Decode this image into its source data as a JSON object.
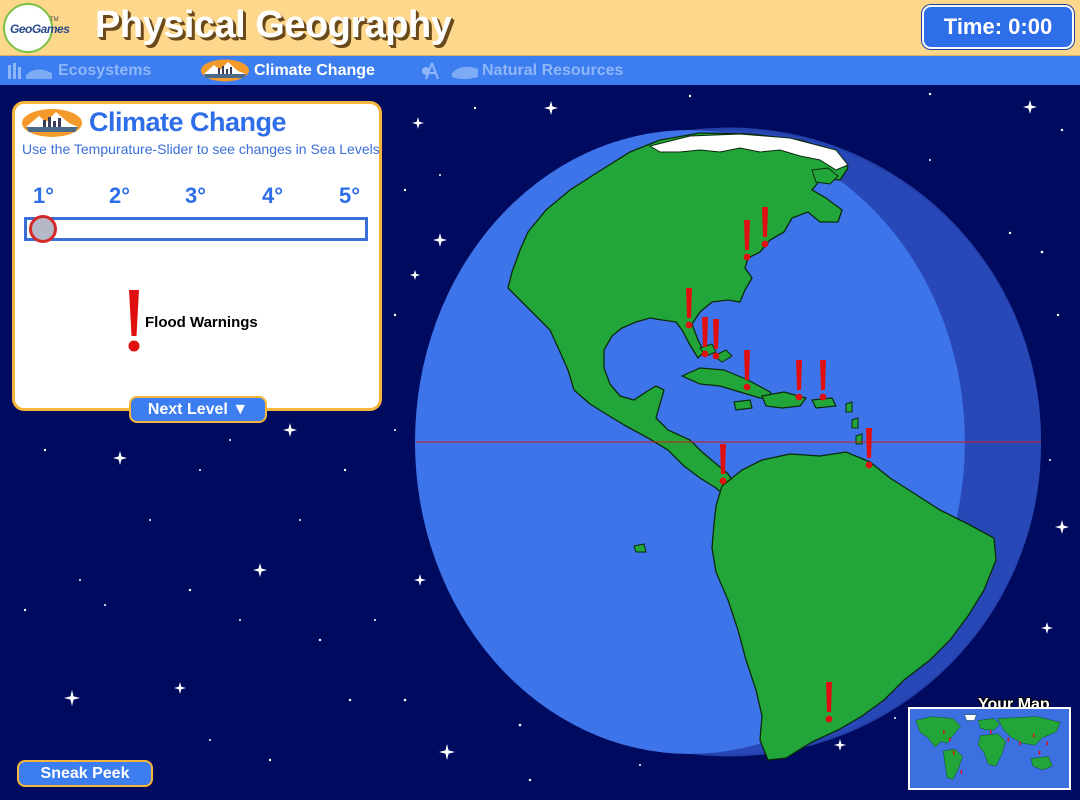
{
  "header": {
    "logo_text": "GeoGames",
    "logo_tm": "TM",
    "title": "Physical Geography",
    "timer": "Time: 0:00"
  },
  "nav": {
    "items": [
      {
        "label": "Ecosystems",
        "active": false
      },
      {
        "label": "Climate Change",
        "active": true
      },
      {
        "label": "Natural Resources",
        "active": false
      }
    ]
  },
  "panel": {
    "title": "Climate Change",
    "subtitle": "Use the Tempurature-Slider to see changes in Sea Levels",
    "slider": {
      "ticks": [
        "1°",
        "2°",
        "3°",
        "4°",
        "5°"
      ],
      "current_value": 1
    },
    "legend_label": "Flood Warnings",
    "next_button": "Next Level ▼"
  },
  "sneak_peek_button": "Sneak Peek",
  "your_map_label": "Your Map",
  "colors": {
    "background": "#000a5e",
    "header": "#fdd78b",
    "nav": "#3c7df0",
    "accent": "#2e6ee8",
    "panel_border": "#f5b53a",
    "ocean": "#3c6fe0",
    "land": "#22a63a",
    "warning": "#e01010"
  },
  "icons": [
    "geogames-logo-icon",
    "ecosystems-icon",
    "climate-change-icon",
    "natural-resources-icon",
    "flood-warning-icon",
    "star-icon"
  ]
}
